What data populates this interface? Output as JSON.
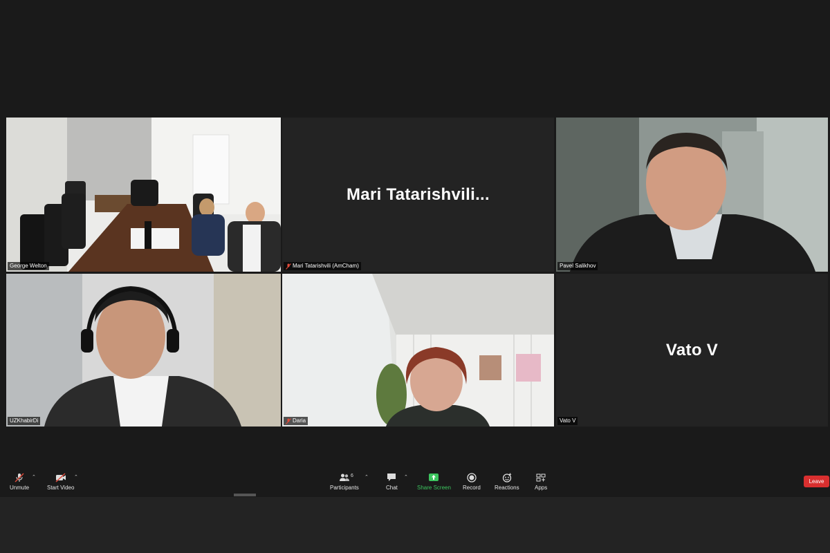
{
  "participants": [
    {
      "name": "George Welton",
      "muted": false,
      "video": true,
      "active_speaker": true
    },
    {
      "name": "Mari Tatarishvili (AmCham)",
      "display_name": "Mari  Tatarishvili...",
      "muted": true,
      "video": false
    },
    {
      "name": "Pavel Salikhov",
      "muted": false,
      "video": true
    },
    {
      "name": "UZKhabirDi",
      "muted": false,
      "video": true
    },
    {
      "name": "Daria",
      "muted": true,
      "video": true
    },
    {
      "name": "Vato V",
      "display_name": "Vato V",
      "muted": false,
      "video": false
    }
  ],
  "toolbar": {
    "unmute": "Unmute",
    "start_video": "Start Video",
    "participants": "Participants",
    "participants_count": "6",
    "chat": "Chat",
    "share_screen": "Share Screen",
    "record": "Record",
    "reactions": "Reactions",
    "apps": "Apps",
    "leave": "Leave"
  },
  "colors": {
    "active_border": "#c6e85a",
    "leave": "#d92f2f",
    "share": "#3cc45e",
    "mute": "#e04a3a"
  },
  "icons": [
    "mic-muted-icon",
    "video-off-icon",
    "participants-icon",
    "chat-icon",
    "share-screen-icon",
    "record-icon",
    "reactions-icon",
    "apps-icon"
  ]
}
